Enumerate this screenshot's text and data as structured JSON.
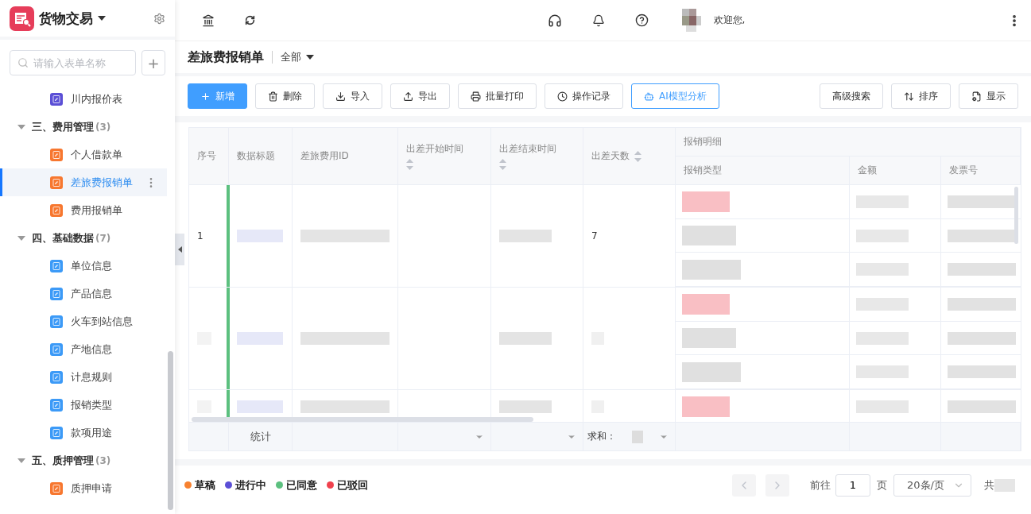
{
  "app": {
    "title": "货物交易"
  },
  "sidebar": {
    "search": {
      "placeholder": "请输入表单名称"
    },
    "add_button": "+",
    "items": [
      {
        "label": "川内报价表",
        "color": "#5b4fd6",
        "selected": false
      },
      {
        "label": "三、费用管理",
        "count": "(3)",
        "expanded": true,
        "children": [
          {
            "label": "个人借款单",
            "color": "#f7772f",
            "selected": false
          },
          {
            "label": "差旅费报销单",
            "color": "#f7772f",
            "selected": true
          },
          {
            "label": "费用报销单",
            "color": "#f7772f",
            "selected": false
          }
        ]
      },
      {
        "label": "四、基础数据",
        "count": "(7)",
        "expanded": true,
        "children": [
          {
            "label": "单位信息",
            "color": "#3c9af7",
            "selected": false
          },
          {
            "label": "产品信息",
            "color": "#3c9af7",
            "selected": false
          },
          {
            "label": "火车到站信息",
            "color": "#3c9af7",
            "selected": false
          },
          {
            "label": "产地信息",
            "color": "#3c9af7",
            "selected": false
          },
          {
            "label": "计息规则",
            "color": "#3c9af7",
            "selected": false
          },
          {
            "label": "报销类型",
            "color": "#3c9af7",
            "selected": false
          },
          {
            "label": "款项用途",
            "color": "#3c9af7",
            "selected": false
          }
        ]
      },
      {
        "label": "五、质押管理",
        "count": "(3)",
        "expanded": true,
        "children": [
          {
            "label": "质押申请",
            "color": "#f7772f",
            "selected": false
          }
        ]
      }
    ]
  },
  "header": {
    "welcome": "欢迎您,"
  },
  "page": {
    "title": "差旅费报销单",
    "filter": "全部"
  },
  "toolbar": {
    "left": [
      {
        "label": "新增",
        "kind": "primary"
      },
      {
        "label": "删除",
        "kind": "default"
      },
      {
        "label": "导入",
        "kind": "default"
      },
      {
        "label": "导出",
        "kind": "default"
      },
      {
        "label": "批量打印",
        "kind": "default"
      },
      {
        "label": "操作记录",
        "kind": "default"
      },
      {
        "label": "AI模型分析",
        "kind": "accent"
      }
    ],
    "right": [
      {
        "label": "高级搜索"
      },
      {
        "label": "排序"
      },
      {
        "label": "显示"
      }
    ]
  },
  "table": {
    "columns": [
      {
        "label": "序号",
        "sortable": false
      },
      {
        "label": "数据标题",
        "sortable": false
      },
      {
        "label": "差旅费用ID",
        "sortable": false
      },
      {
        "label": "出差开始时间",
        "sortable": true
      },
      {
        "label": "出差结束时间",
        "sortable": true
      },
      {
        "label": "出差天数",
        "sortable": true
      }
    ],
    "group": {
      "label": "报销明细",
      "columns": [
        "报销类型",
        "金额",
        "发票号"
      ]
    },
    "rows": [
      {
        "index": "1",
        "days": "7",
        "color": "#5cc07f",
        "details": [
          {
            "kind": "highlighted"
          },
          {
            "kind": "plain"
          },
          {
            "kind": "plain"
          }
        ]
      },
      {
        "color": "#5cc07f",
        "details": [
          {
            "kind": "highlighted"
          },
          {
            "kind": "plain"
          },
          {
            "kind": "plain"
          }
        ]
      },
      {
        "color": "#5cc07f",
        "details": [
          {
            "kind": "highlighted"
          }
        ]
      }
    ],
    "summary": {
      "label": "统计",
      "sum_label": "求和："
    }
  },
  "legend": [
    {
      "label": "草稿",
      "color": "#f7812f"
    },
    {
      "label": "进行中",
      "color": "#5b4fd6"
    },
    {
      "label": "已同意",
      "color": "#5cc07f"
    },
    {
      "label": "已驳回",
      "color": "#f0414d"
    }
  ],
  "pagination": {
    "prev_disabled": true,
    "next_disabled": true,
    "goto_label": "前往",
    "page": "1",
    "page_unit": "页",
    "page_size": "20条/页",
    "total_label": "共"
  }
}
